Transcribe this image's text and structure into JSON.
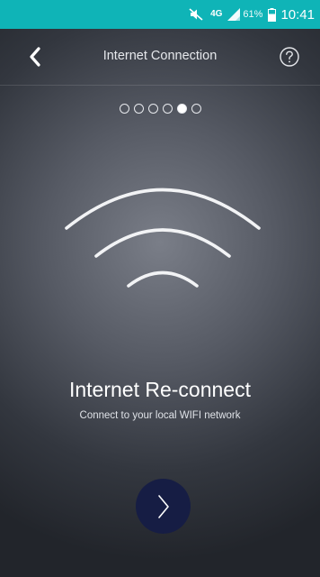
{
  "status_bar": {
    "network": "4G",
    "network_sub": "ↆ",
    "battery_percent": "61%",
    "time": "10:41",
    "icons": [
      "mute-icon",
      "signal-icon",
      "battery-icon"
    ],
    "background_color": "#0fb4b7"
  },
  "header": {
    "title": "Internet Connection",
    "back_icon": "chevron-left-icon",
    "help_icon": "help-circle-icon"
  },
  "pager": {
    "total_steps": 6,
    "active_step": 5
  },
  "main": {
    "illustration_icon": "wifi-icon",
    "headline": "Internet Re-connect",
    "subline": "Connect to your local WIFI network",
    "next_icon": "chevron-right-icon",
    "next_button_color": "#161d44"
  }
}
